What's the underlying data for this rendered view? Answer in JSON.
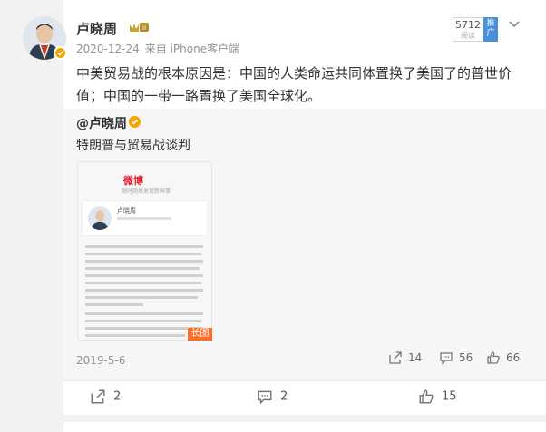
{
  "post": {
    "username": "卢晓周",
    "vip_badge_text": "II",
    "date": "2020-12-24",
    "source": "来自 iPhone客户端",
    "read_count": "5712",
    "read_label": "阅读",
    "promote_label": "推广",
    "text": "中美贸易战的根本原因是：中国的人类命运共同体置换了美国了的普世价值；中国的一带一路置换了美国全球化。",
    "menu_icon": "chevron-down-icon"
  },
  "repost": {
    "username": "@卢晓周",
    "text": "特朗普与贸易战谈判",
    "long_image": {
      "logo_text": "微博",
      "logo_sub": "随时随地发现新鲜事",
      "profile_name": "卢晓周",
      "badge": "长图"
    },
    "date": "2019-5-6",
    "share_count": "14",
    "comment_count": "56",
    "like_count": "66"
  },
  "footer": {
    "share_count": "2",
    "comment_count": "2",
    "like_count": "15"
  },
  "colors": {
    "accent_orange": "#ff6d2c",
    "verified_gold": "#f7a400",
    "promote_blue": "#4a90d9",
    "meta_gray": "#939393"
  }
}
